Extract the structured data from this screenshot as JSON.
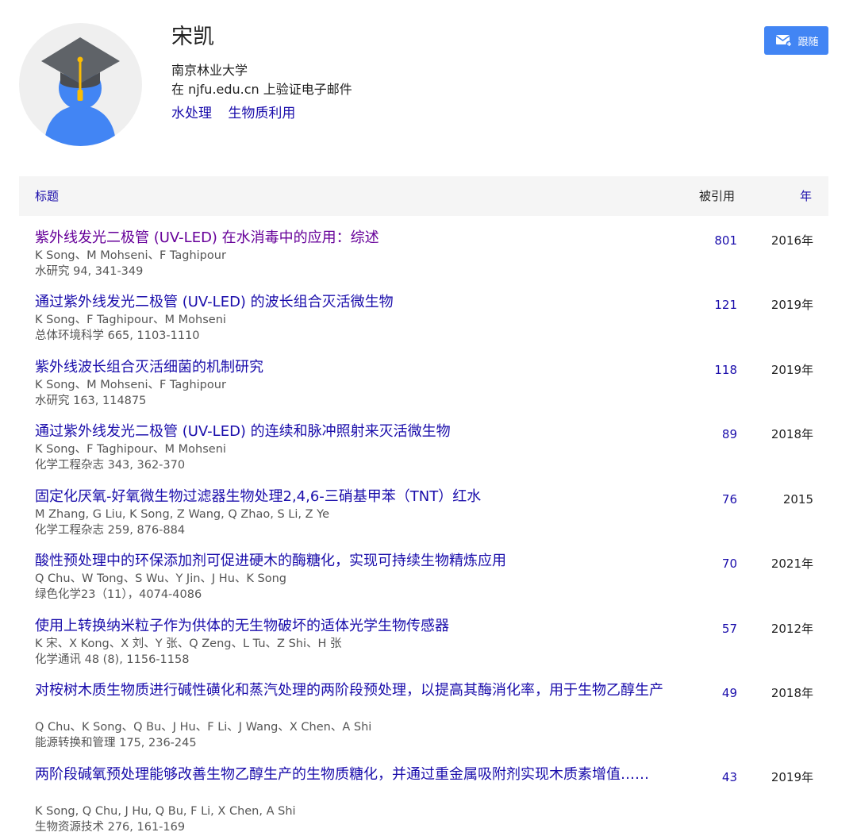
{
  "profile": {
    "name": "宋凯",
    "affiliation": "南京林业大学",
    "verified_email": "在 njfu.edu.cn 上验证电子邮件",
    "interests": [
      "水处理",
      "生物质利用"
    ],
    "avatar_icon": "graduation-cap-avatar-icon"
  },
  "follow_button": {
    "label": "跟随",
    "icon": "mail-plus-icon",
    "color": "#4285f4"
  },
  "table": {
    "header": {
      "title": "标题",
      "cited_by": "被引用",
      "year": "年"
    },
    "rows": [
      {
        "title": "紫外线发光二极管 (UV-LED) 在水消毒中的应用：综述",
        "authors": "K Song、M Mohseni、F Taghipour",
        "venue": "水研究 94, 341-349",
        "cites": "801",
        "year": "2016年",
        "visited": true
      },
      {
        "title": "通过紫外线发光二极管 (UV-LED) 的波长组合灭活微生物",
        "authors": "K Song、F Taghipour、M Mohseni",
        "venue": "总体环境科学 665, 1103-1110",
        "cites": "121",
        "year": "2019年"
      },
      {
        "title": "紫外线波长组合灭活细菌的机制研究",
        "authors": "K Song、M Mohseni、F Taghipour",
        "venue": "水研究 163, 114875",
        "cites": "118",
        "year": "2019年"
      },
      {
        "title": "通过紫外线发光二极管 (UV-LED) 的连续和脉冲照射来灭活微生物",
        "authors": "K Song、F Taghipour、M Mohseni",
        "venue": "化学工程杂志 343, 362-370",
        "cites": "89",
        "year": "2018年"
      },
      {
        "title": "固定化厌氧-好氧微生物过滤器生物处理2,4,6-三硝基甲苯（TNT）红水",
        "authors": "M Zhang, G Liu, K Song, Z Wang, Q Zhao, S Li, Z Ye",
        "venue": "化学工程杂志 259, 876-884",
        "cites": "76",
        "year": "2015"
      },
      {
        "title": "酸性预处理中的环保添加剂可促进硬木的酶糖化，实现可持续生物精炼应用",
        "authors": "Q Chu、W Tong、S Wu、Y Jin、J Hu、K Song",
        "venue": "绿色化学23（11），4074-4086",
        "cites": "70",
        "year": "2021年"
      },
      {
        "title": "使用上转换纳米粒子作为供体的无生物破坏的适体光学生物传感器",
        "authors": "K 宋、X Kong、X 刘、Y 张、Q Zeng、L Tu、Z Shi、H 张",
        "venue": "化学通讯 48 (8), 1156-1158",
        "cites": "57",
        "year": "2012年"
      },
      {
        "title": "对桉树木质生物质进行碱性磺化和蒸汽处理的两阶段预处理，以提高其酶消化率，用于生物乙醇生产",
        "authors": "Q Chu、K Song、Q Bu、J Hu、F Li、J Wang、X Chen、A Shi",
        "venue": "能源转换和管理 175, 236-245",
        "cites": "49",
        "year": "2018年"
      },
      {
        "title": "两阶段碱氧预处理能够改善生物乙醇生产的生物质糖化，并通过重金属吸附剂实现木质素增值……",
        "authors": "K Song, Q Chu, J Hu, Q Bu, F Li, X Chen, A Shi",
        "venue": "生物资源技术 276, 161-169",
        "cites": "43",
        "year": "2019年"
      }
    ]
  },
  "colors": {
    "link": "#1a0dab",
    "visited": "#660099",
    "meta": "#555555",
    "header_bg": "#f5f5f5"
  }
}
